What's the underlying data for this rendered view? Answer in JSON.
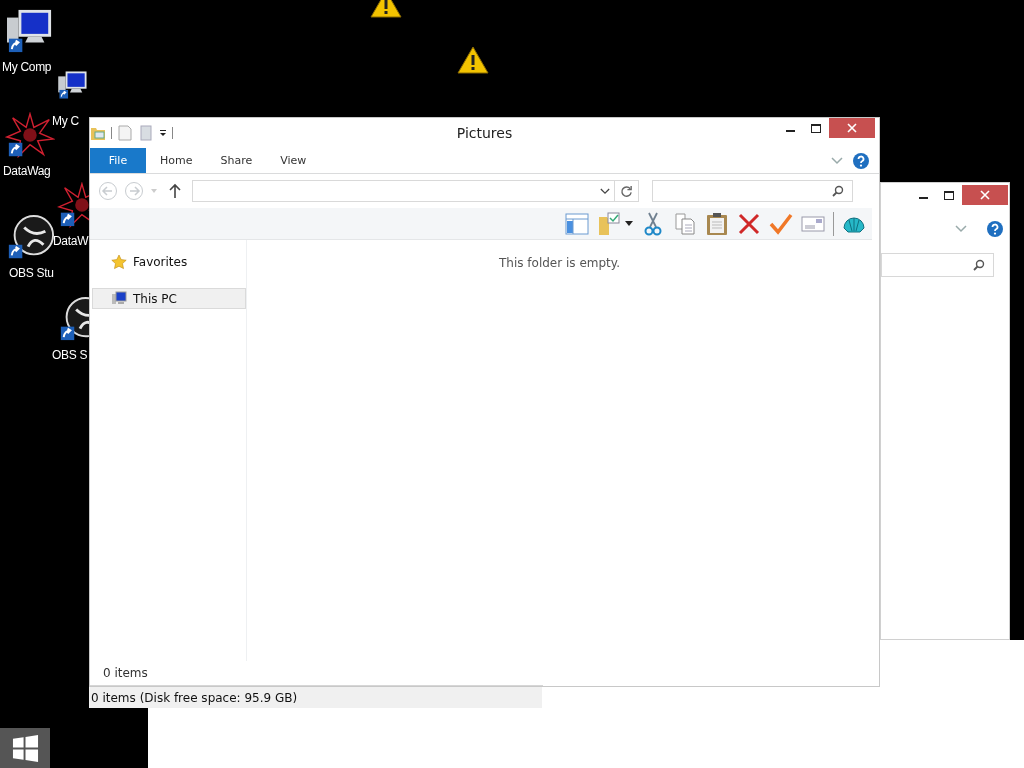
{
  "desktop_icons": [
    {
      "label": "My Comp",
      "kind": "computer"
    },
    {
      "label": "My C",
      "kind": "computer"
    },
    {
      "label": "DataWag",
      "kind": "datawag"
    },
    {
      "label": "DataW",
      "kind": "datawag"
    },
    {
      "label": "OBS Stu",
      "kind": "obs"
    },
    {
      "label": "OBS S",
      "kind": "obs"
    }
  ],
  "window": {
    "title": "Pictures",
    "tabs": [
      {
        "label": "File",
        "kind": "file"
      },
      {
        "label": "Home",
        "kind": "tab"
      },
      {
        "label": "Share",
        "kind": "tab"
      },
      {
        "label": "View",
        "kind": "tab"
      }
    ],
    "navigation": [
      {
        "label": "Favorites",
        "kind": "favorites",
        "selected": false
      },
      {
        "label": "This PC",
        "kind": "pc",
        "selected": true
      }
    ],
    "empty_message": "This folder is empty.",
    "item_count": "0 items",
    "status_bar": "0 items (Disk free space: 95.9 GB)"
  }
}
